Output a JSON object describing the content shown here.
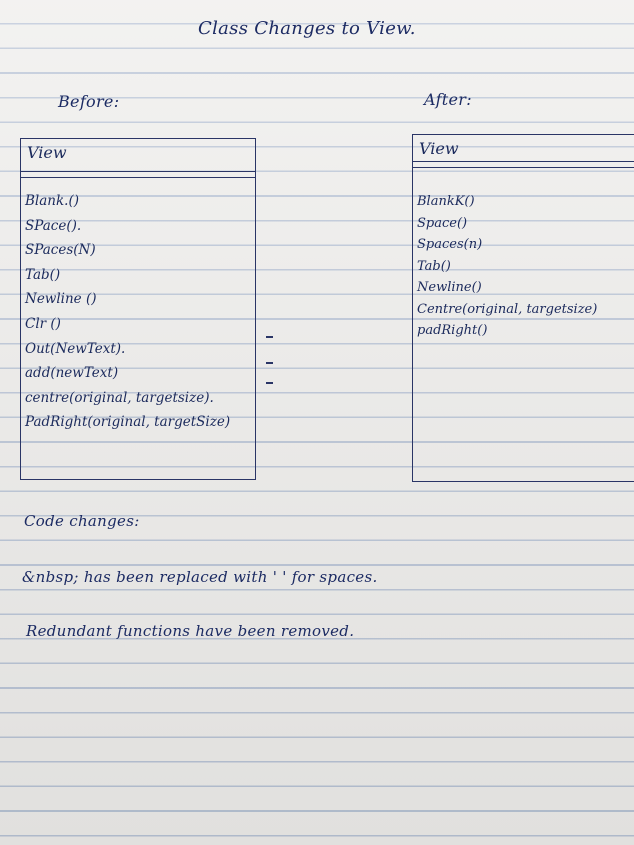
{
  "title": "Class Changes to View.",
  "before_label": "Before:",
  "after_label": "After:",
  "before_class": {
    "name": "View",
    "methods": [
      "Blank.()",
      "SPace().",
      "SPaces(N)",
      "Tab()",
      "Newline ()",
      "Clr ()",
      "Out(NewText).",
      "add(newText)",
      "centre(original, targetsize).",
      "PadRight(original, targetSize)"
    ]
  },
  "after_class": {
    "name": "View",
    "methods": [
      "BlankK()",
      "Space()",
      "Spaces(n)",
      "Tab()",
      "Newline()",
      "Centre(original, targetsize)",
      "padRight()"
    ]
  },
  "removed_markers": [
    "-",
    "-",
    "-"
  ],
  "notes": {
    "heading": "Code changes:",
    "line1": "&nbsp; has been replaced with ' ' for spaces.",
    "line2": "Redundant functions have been removed."
  }
}
